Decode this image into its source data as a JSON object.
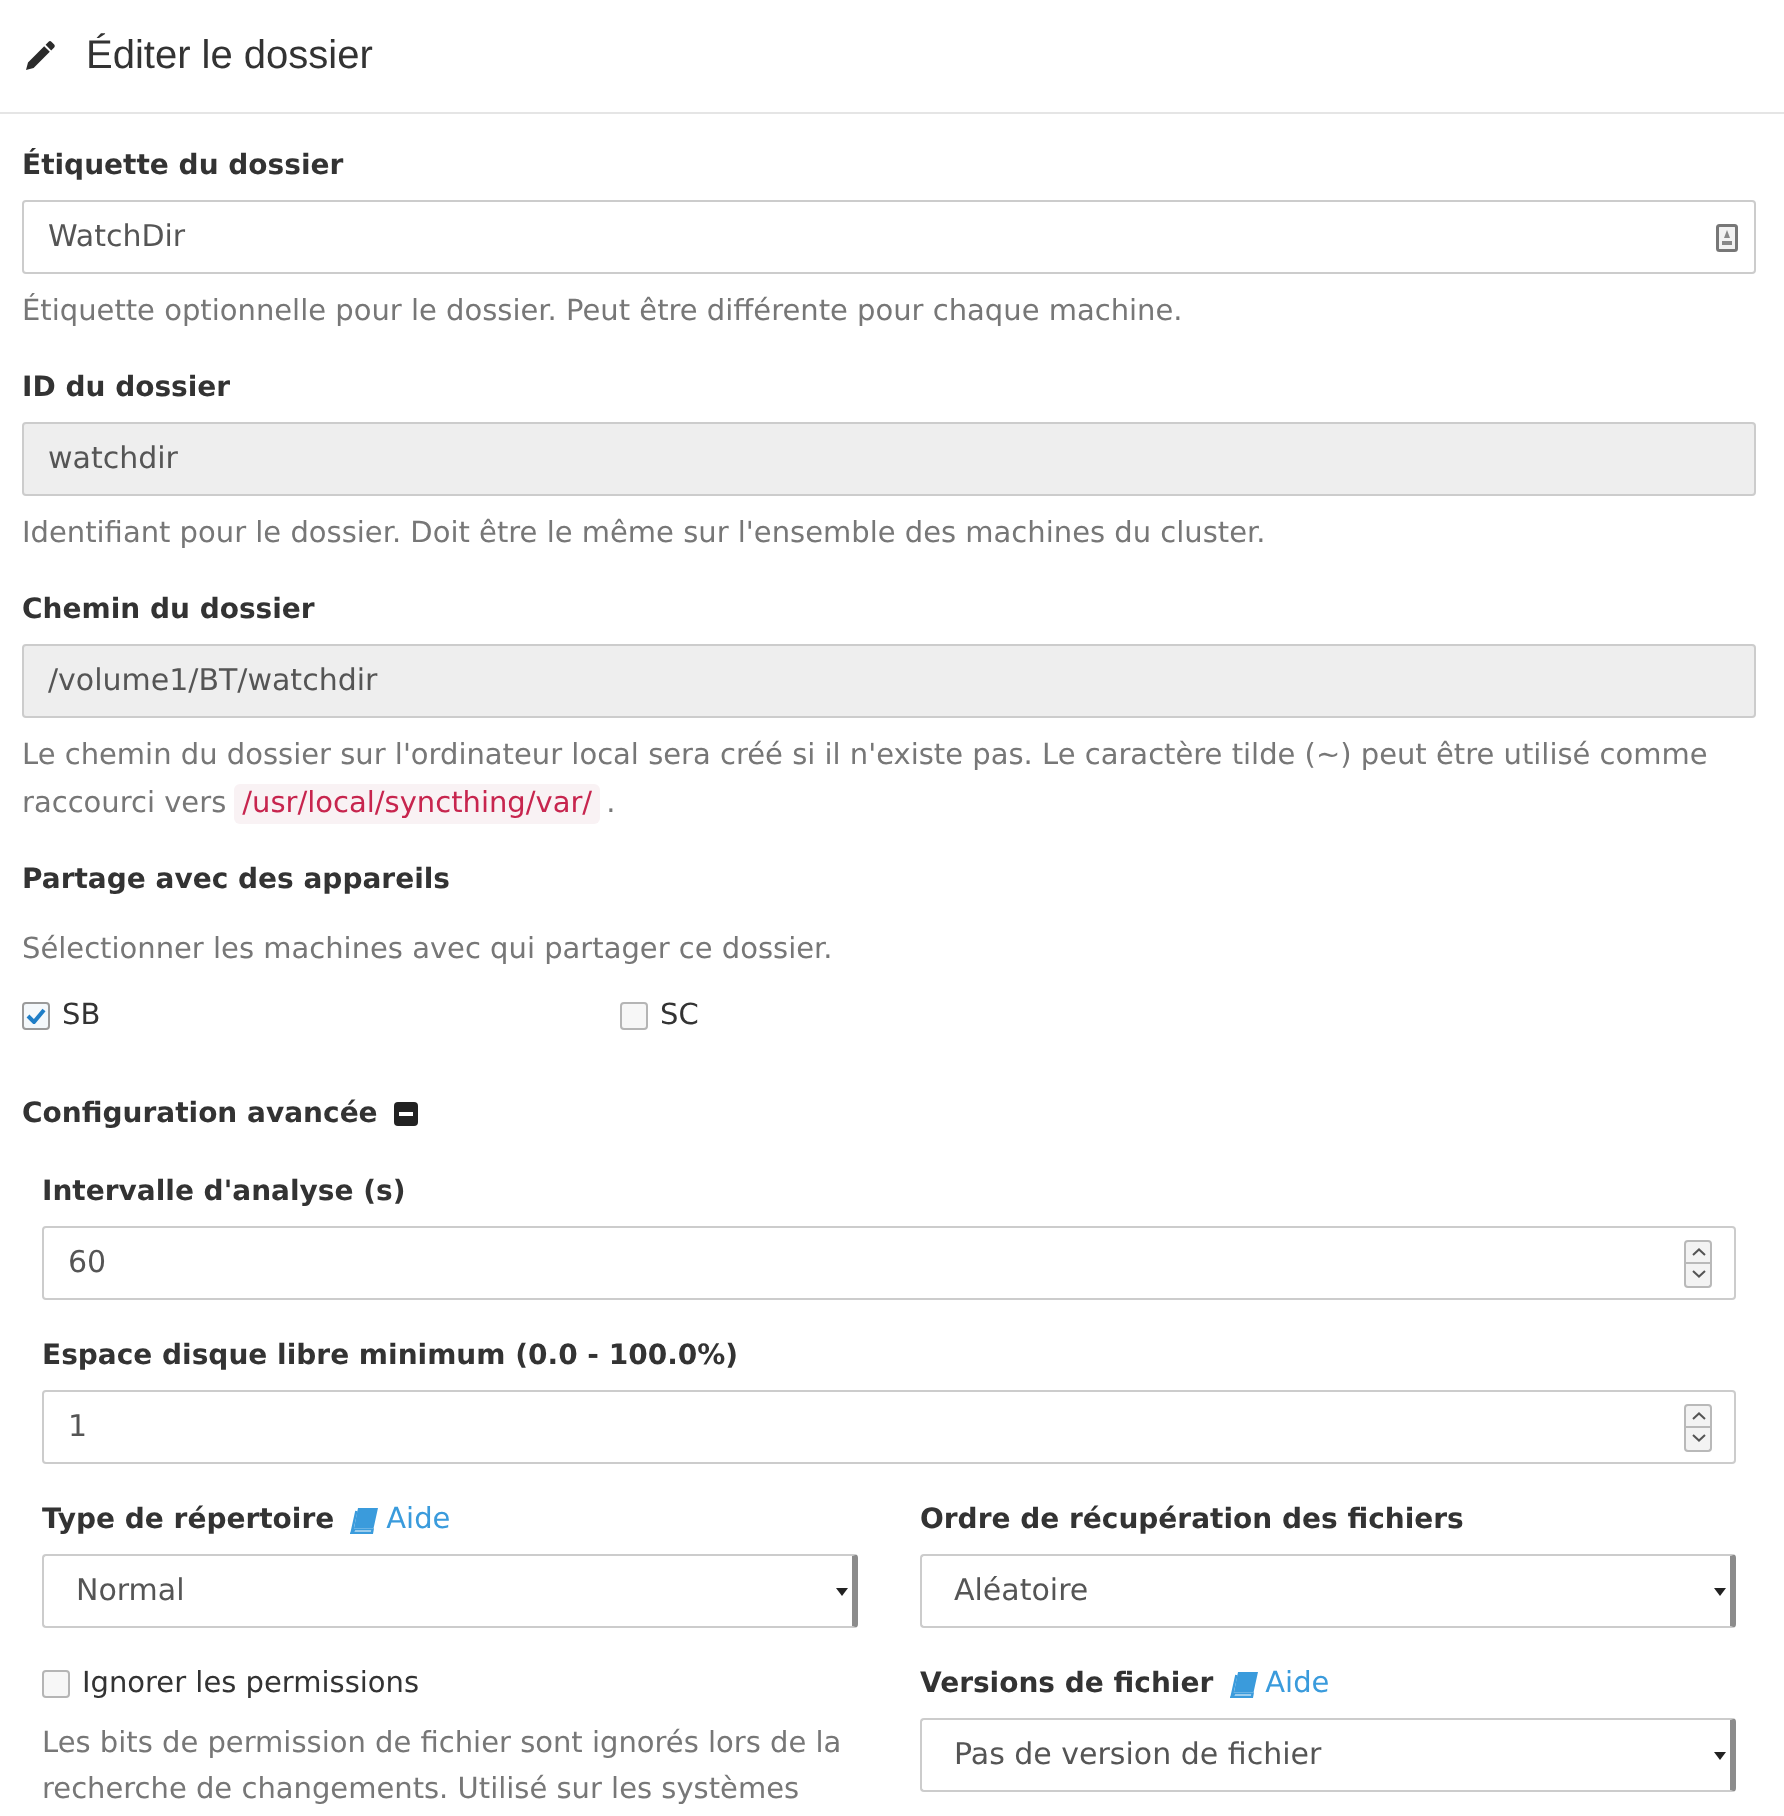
{
  "header": {
    "title": "Éditer le dossier"
  },
  "fields": [
    {
      "label": "Étiquette du dossier",
      "value": "WatchDir",
      "disabled": false,
      "help": [
        {
          "kind": "text",
          "text": "Étiquette optionnelle pour le dossier. Peut être différente pour chaque machine."
        }
      ]
    },
    {
      "label": "ID du dossier",
      "value": "watchdir",
      "disabled": true,
      "help": [
        {
          "kind": "text",
          "text": "Identifiant pour le dossier. Doit être le même sur l'ensemble des machines du cluster."
        }
      ]
    },
    {
      "label": "Chemin du dossier",
      "value": "/volume1/BT/watchdir",
      "disabled": true,
      "help": [
        {
          "kind": "text",
          "text": "Le chemin du dossier sur l'ordinateur local sera créé si il n'existe pas. Le caractère tilde (~) peut être utilisé comme raccourci vers"
        },
        {
          "kind": "code",
          "text": "/usr/local/syncthing/var/"
        },
        {
          "kind": "text",
          "text": "."
        }
      ]
    }
  ],
  "sharing": {
    "title": "Partage avec des appareils",
    "hint": "Sélectionner les machines avec qui partager ce dossier.",
    "devices": [
      {
        "name": "SB",
        "checked": true
      },
      {
        "name": "SC",
        "checked": false
      }
    ]
  },
  "advanced": {
    "title": "Configuration avancée",
    "expanded": true,
    "fields": [
      {
        "label": "Intervalle d'analyse (s)",
        "value": "60"
      },
      {
        "label": "Espace disque libre minimum (0.0 - 100.0%)",
        "value": "1"
      }
    ],
    "columns": [
      [
        {
          "kind": "select",
          "label": "Type de répertoire",
          "help_link": "Aide",
          "value": "Normal"
        },
        {
          "kind": "checkbox",
          "label": "Ignorer les permissions",
          "checked": false,
          "help": "Les bits de permission de fichier sont ignorés lors de la recherche de changements. Utilisé sur les systèmes"
        }
      ],
      [
        {
          "kind": "select",
          "label": "Ordre de récupération des fichiers",
          "value": "Aléatoire"
        },
        {
          "kind": "select",
          "label": "Versions de fichier",
          "help_link": "Aide",
          "value": "Pas de version de fichier"
        }
      ]
    ]
  }
}
